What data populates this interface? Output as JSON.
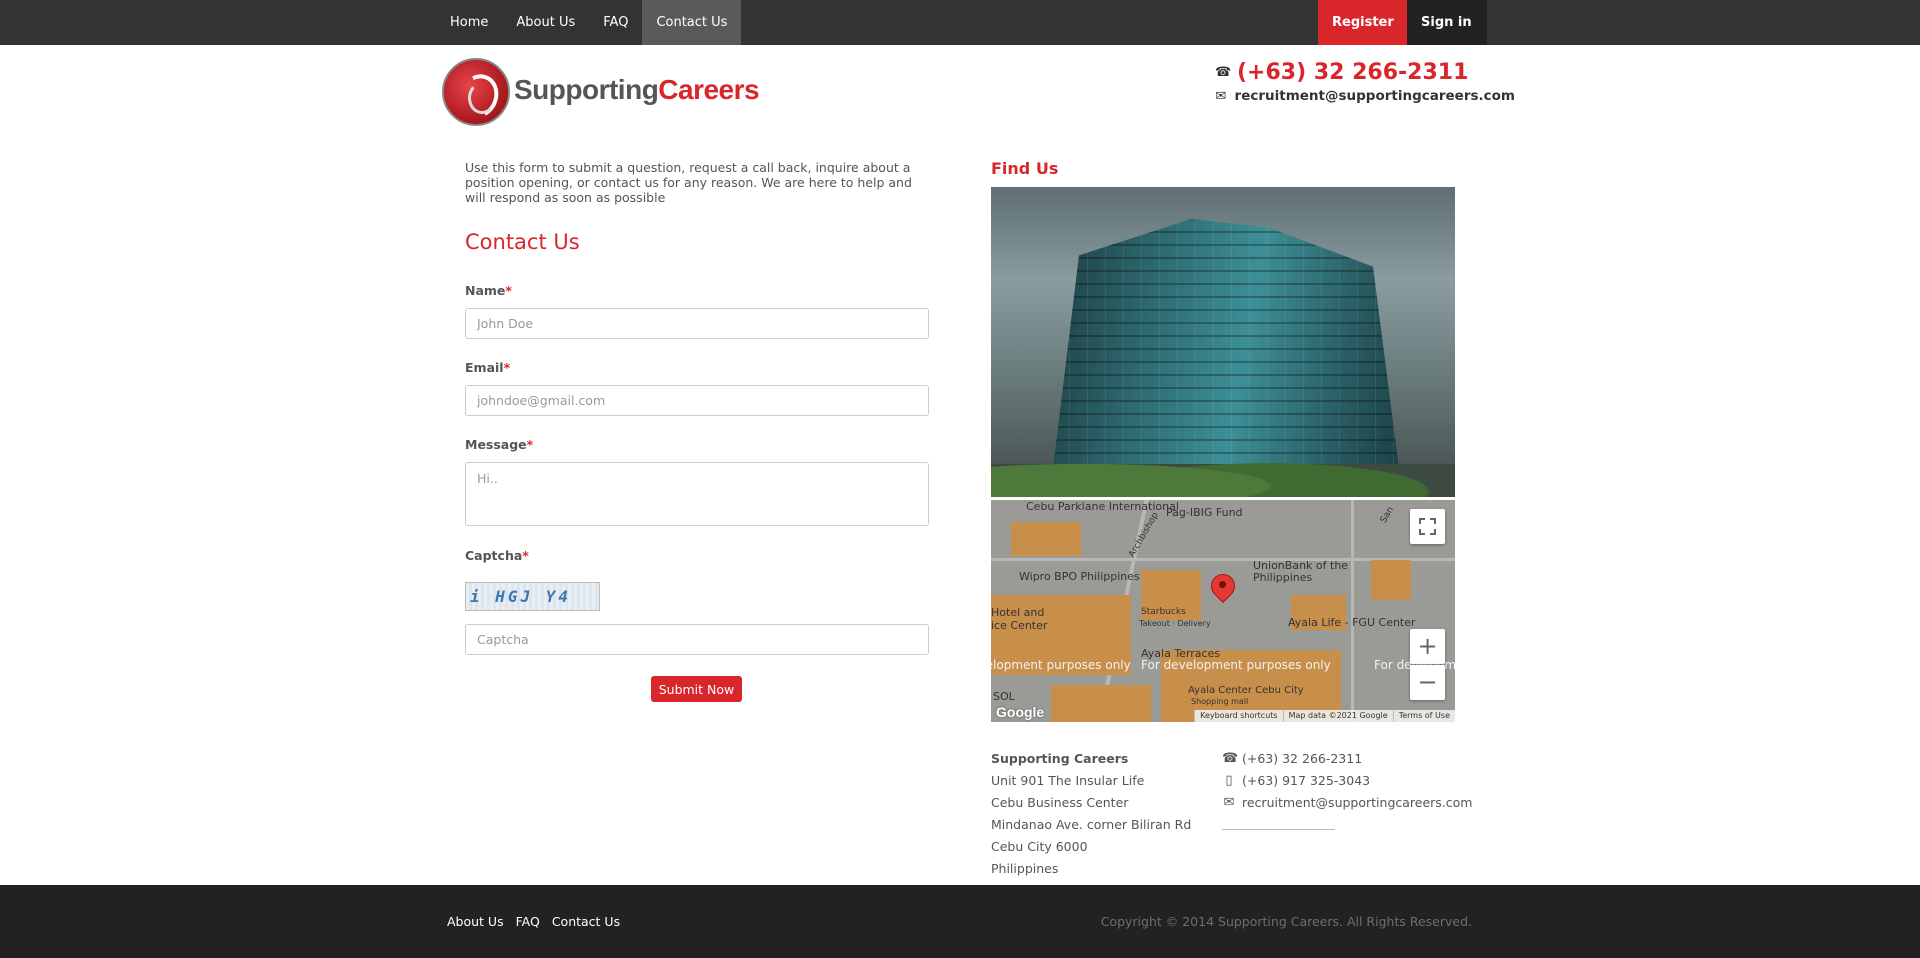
{
  "nav": {
    "items": [
      "Home",
      "About Us",
      "FAQ",
      "Contact Us"
    ],
    "active": "Contact Us",
    "register_label": "Register",
    "signin_label": "Sign in"
  },
  "header": {
    "logo_word_1": "Supporting",
    "logo_word_2": "Careers",
    "phone": "(+63) 32 266-2311",
    "email": "recruitment@supportingcareers.com"
  },
  "form": {
    "intro": "Use this form to submit a question, request a call back, inquire about a position opening, or contact us for any reason. We are here to help and will respond as soon as possible",
    "title": "Contact Us",
    "name_label": "Name",
    "name_placeholder": "John Doe",
    "email_label": "Email",
    "email_placeholder": "johndoe@gmail.com",
    "message_label": "Message",
    "message_placeholder": "Hi..",
    "captcha_label": "Captcha",
    "captcha_image_text": "i HGJ Y4",
    "captcha_placeholder": "Captcha",
    "required_mark": "*",
    "submit_label": "Submit Now"
  },
  "find": {
    "title": "Find Us",
    "map": {
      "labels": [
        "Cebu Parklane International",
        "Pag-IBIG Fund",
        "Archbishop",
        "UnionBank of the Philippines",
        "Wipro BPO Philippines",
        "Hotel and ice Center",
        "Starbucks",
        "Takeout · Delivery",
        "Ayala Life - FGU Center",
        "Ayala Terraces",
        "Ayala Center Cebu City",
        "Shopping mall",
        "SOL",
        "San"
      ],
      "watermark": "For development purposes only",
      "zoom_in": "+",
      "zoom_out": "−",
      "attribution": [
        "Keyboard shortcuts",
        "Map data ©2021 Google",
        "Terms of Use"
      ],
      "google_logo": "Google"
    }
  },
  "address": {
    "name": "Supporting Careers",
    "lines": [
      "Unit 901 The Insular Life",
      "Cebu Business Center",
      "Mindanao Ave. corner Biliran Rd",
      "Cebu City 6000",
      "Philippines"
    ],
    "phone": "(+63) 32 266-2311",
    "mobile": "(+63) 917 325-3043",
    "email": "recruitment@supportingcareers.com"
  },
  "footer": {
    "links": [
      "About Us",
      "FAQ",
      "Contact Us"
    ],
    "copyright": "Copyright © 2014 Supporting Careers. All Rights Reserved."
  },
  "colors": {
    "accent": "#d9262b",
    "nav_bg": "#333333",
    "footer_bg": "#222222"
  }
}
